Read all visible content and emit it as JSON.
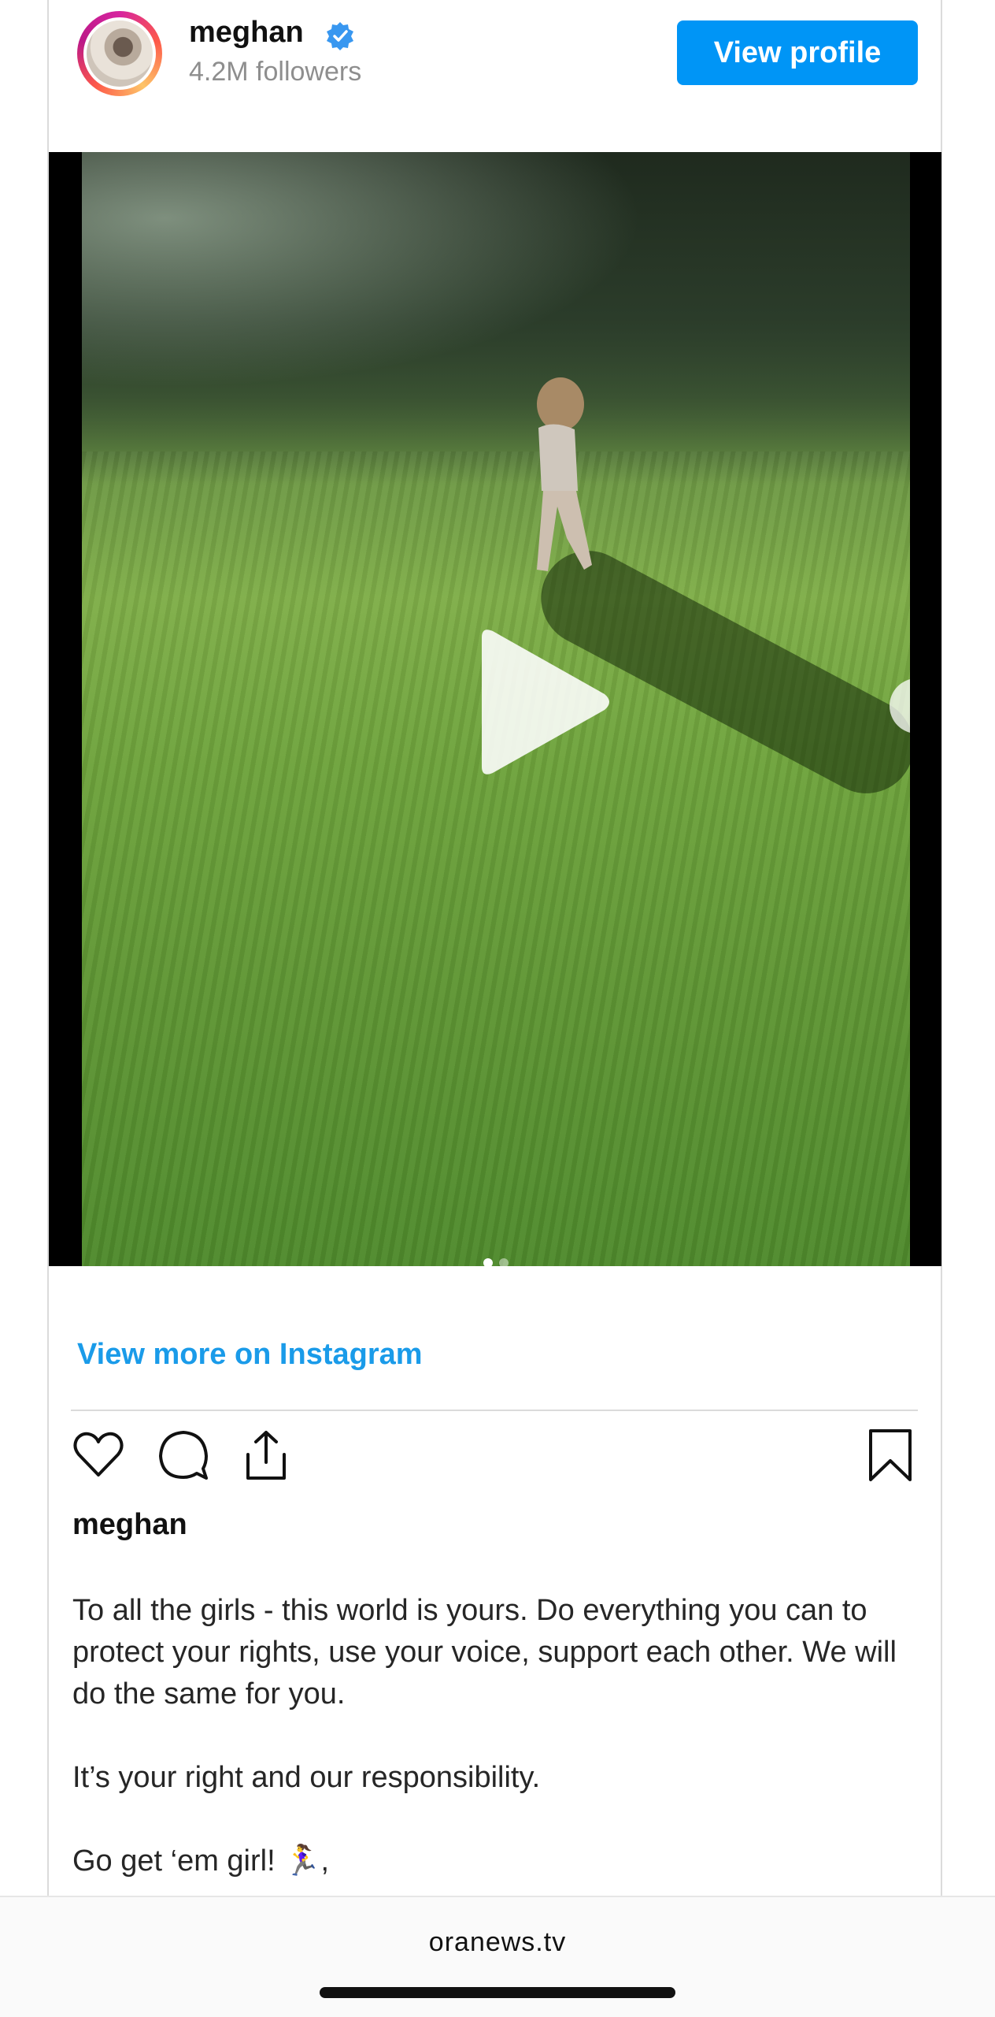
{
  "header": {
    "username": "meghan",
    "followers": "4.2M followers",
    "view_profile_label": "View profile",
    "avatar_icon": "avatar-photo",
    "verified_icon": "verified-badge-icon"
  },
  "media": {
    "play_icon": "play-icon",
    "next_icon": "chevron-right-icon",
    "carousel": {
      "active_index": 1,
      "total": 2
    }
  },
  "view_more_label": "View more on Instagram",
  "actions": {
    "like_icon": "heart-icon",
    "comment_icon": "comment-icon",
    "share_icon": "share-icon",
    "save_icon": "bookmark-icon"
  },
  "caption": {
    "username": "meghan",
    "line1": "To all the girls - this world is yours. Do everything you can to protect your rights, use your voice, support each other. We will do the same for you.",
    "line2": "It’s your right and our responsibility.",
    "line3": "Go get ‘em girl! 🏃‍♀️,"
  },
  "footer": {
    "domain": "oranews.tv"
  },
  "colors": {
    "accent": "#0095f6",
    "link": "#1a9be9",
    "text": "#262626",
    "muted": "#8e8e8e"
  }
}
